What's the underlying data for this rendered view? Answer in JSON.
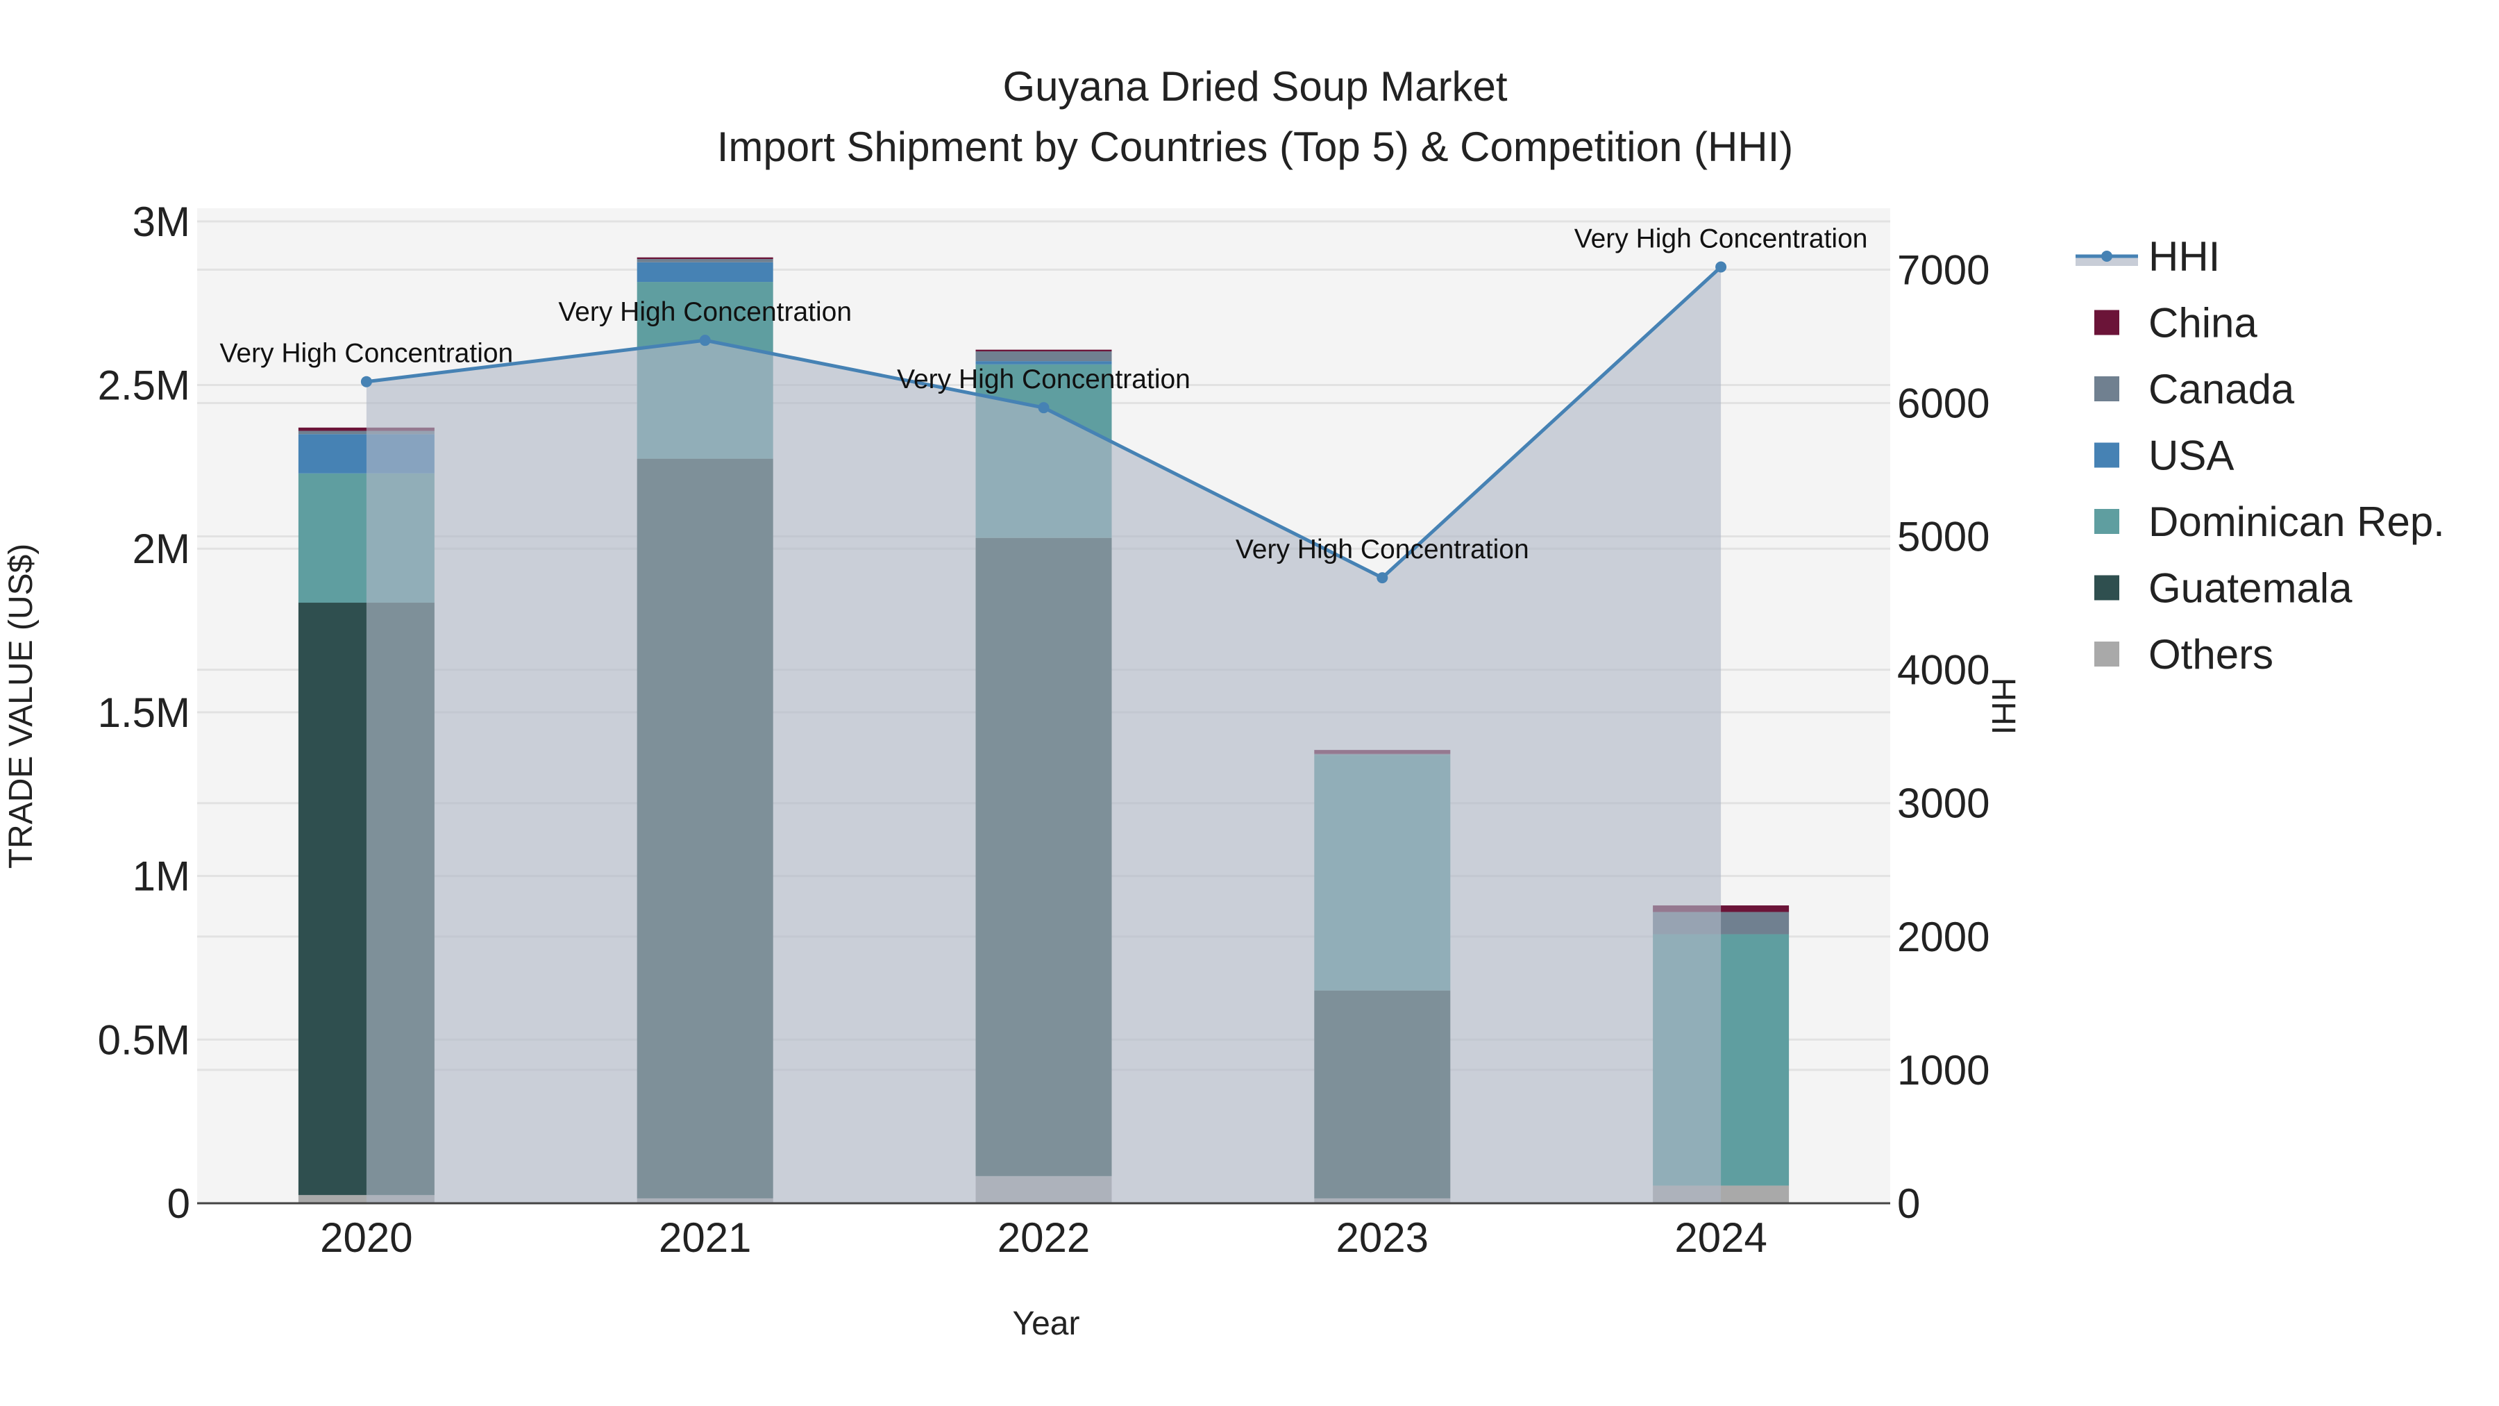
{
  "chart_data": {
    "type": "bar",
    "title": "Guyana Dried Soup Market",
    "subtitle": "Import Shipment by Countries (Top 5) & Competition (HHI)",
    "xlabel": "Year",
    "ylabel": "TRADE VALUE (US$)",
    "y2label": "HHI",
    "categories": [
      "2020",
      "2021",
      "2022",
      "2023",
      "2024"
    ],
    "stacked": true,
    "ylim": [
      0,
      3040000
    ],
    "y2lim": [
      0,
      7460
    ],
    "yticks": [
      0,
      500000,
      1000000,
      1500000,
      2000000,
      2500000,
      3000000
    ],
    "ytick_labels": [
      "0",
      "0.5M",
      "1M",
      "1.5M",
      "2M",
      "2.5M",
      "3M"
    ],
    "y2ticks": [
      0,
      1000,
      2000,
      3000,
      4000,
      5000,
      6000,
      7000
    ],
    "y2tick_labels": [
      "0",
      "1000",
      "2000",
      "3000",
      "4000",
      "5000",
      "6000",
      "7000"
    ],
    "grid": true,
    "legend_position": "right",
    "series": [
      {
        "name": "Others",
        "color": "#a9a9a9",
        "values": [
          25000,
          15000,
          83000,
          15000,
          54000
        ]
      },
      {
        "name": "Guatemala",
        "color": "#2f4f4f",
        "values": [
          1810000,
          2260000,
          1950000,
          635000,
          0
        ]
      },
      {
        "name": "Dominican Rep.",
        "color": "#5f9ea0",
        "values": [
          395000,
          540000,
          530000,
          720000,
          768000
        ]
      },
      {
        "name": "USA",
        "color": "#4682b4",
        "values": [
          120000,
          60000,
          10000,
          0,
          0
        ]
      },
      {
        "name": "Canada",
        "color": "#708090",
        "values": [
          10000,
          10000,
          30000,
          3000,
          68000
        ]
      },
      {
        "name": "China",
        "color": "#6b1438",
        "values": [
          10000,
          5000,
          5000,
          12000,
          20000
        ]
      }
    ],
    "line_series": {
      "name": "HHI",
      "color": "#4682b4",
      "fill_color": "#b0b8c6",
      "axis": "y2",
      "values": [
        6160,
        6470,
        5965,
        4690,
        7020
      ],
      "annotations": [
        "Very High Concentration",
        "Very High Concentration",
        "Very High Concentration",
        "Very High Concentration",
        "Very High Concentration"
      ]
    },
    "legend_order": [
      "HHI",
      "China",
      "Canada",
      "USA",
      "Dominican Rep.",
      "Guatemala",
      "Others"
    ]
  }
}
